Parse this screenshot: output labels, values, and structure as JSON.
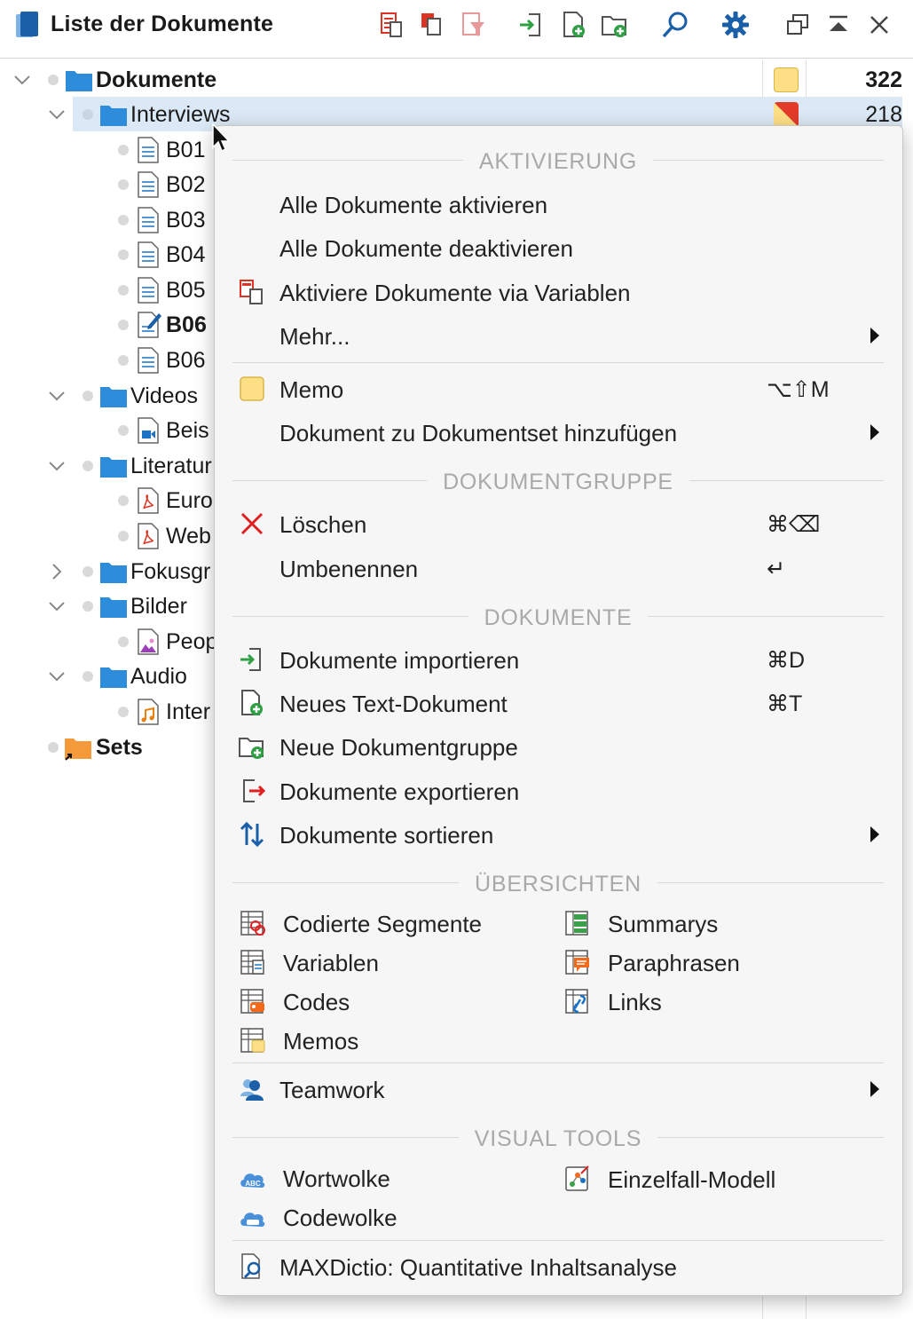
{
  "window": {
    "title": "Liste der Dokumente"
  },
  "toolbar": {
    "buttons": [
      "activate-by-variables-icon",
      "copy-docs-icon",
      "filter-icon",
      "import-icon",
      "new-text-doc-icon",
      "new-doc-group-icon",
      "search-icon",
      "settings-icon",
      "undock-icon",
      "collapse-icon",
      "close-icon"
    ]
  },
  "tree": {
    "root": {
      "label": "Dokumente",
      "count": "322"
    },
    "interviews": {
      "label": "Interviews",
      "count": "218"
    },
    "docs": {
      "b01": "B01",
      "b02": "B02",
      "b03": "B03",
      "b04": "B04",
      "b05": "B05",
      "b06_edit": "B06",
      "b06": "B06"
    },
    "videos": {
      "label": "Videos",
      "child": "Beis"
    },
    "literatur": {
      "label": "Literatur",
      "child1": "Euro",
      "child2": "Web"
    },
    "fokus": {
      "label": "Fokusgr"
    },
    "bilder": {
      "label": "Bilder",
      "child": "Peop"
    },
    "audio": {
      "label": "Audio",
      "child": "Inter"
    },
    "sets": {
      "label": "Sets"
    }
  },
  "menu": {
    "sections": {
      "aktivierung": "AKTIVIERUNG",
      "dokumentgruppe": "DOKUMENTGRUPPE",
      "dokumente": "DOKUMENTE",
      "uebersichten": "ÜBERSICHTEN",
      "visual": "VISUAL TOOLS"
    },
    "items": {
      "alle_aktivieren": "Alle Dokumente aktivieren",
      "alle_deaktivieren": "Alle Dokumente deaktivieren",
      "via_variablen": "Aktiviere Dokumente via Variablen",
      "mehr": "Mehr...",
      "memo": "Memo",
      "memo_sc": "⌥⇧M",
      "dokumentset": "Dokument zu Dokumentset hinzufügen",
      "loeschen": "Löschen",
      "loeschen_sc": "⌘⌫",
      "umbenennen": "Umbenennen",
      "umbenennen_sc": "↵",
      "importieren": "Dokumente importieren",
      "importieren_sc": "⌘D",
      "neues_text": "Neues Text-Dokument",
      "neues_text_sc": "⌘T",
      "neue_gruppe": "Neue Dokumentgruppe",
      "exportieren": "Dokumente exportieren",
      "sortieren": "Dokumente sortieren",
      "teamwork": "Teamwork",
      "maxdictio": "MAXDictio: Quantitative Inhaltsanalyse"
    },
    "overviews": {
      "codierte": "Codierte Segmente",
      "variablen": "Variablen",
      "codes": "Codes",
      "memos": "Memos",
      "summarys": "Summarys",
      "paraphrasen": "Paraphrasen",
      "links": "Links"
    },
    "visual": {
      "wortwolke": "Wortwolke",
      "codewolke": "Codewolke",
      "einzelfall": "Einzelfall-Modell"
    }
  },
  "colors": {
    "accent_blue": "#1a73c7",
    "folder_blue": "#2d8ddb",
    "selection": "#dbe8f5",
    "memo_yellow": "#fddf85",
    "delete_red": "#e02020",
    "section_gray": "#a9a9a9"
  }
}
